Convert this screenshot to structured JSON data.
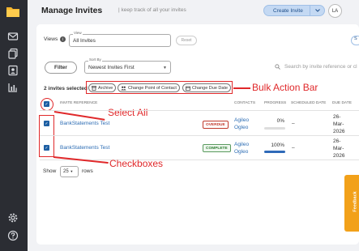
{
  "header": {
    "title": "Manage Invites",
    "subtitle": "| keep track of all your invites",
    "create_button": "Create Invite",
    "avatar_initials": "LA"
  },
  "views": {
    "label": "Views",
    "caption": "View",
    "value": "All Invites",
    "reset": "Reset",
    "edge_button": "S"
  },
  "toolbar": {
    "filter": "Filter",
    "sort_caption": "Sort By",
    "sort_value": "Newest Invites First",
    "search_placeholder": "Search by invite reference or cl"
  },
  "bulk": {
    "selected_text": "2 invites selected",
    "archive": "Archive",
    "change_contact": "Change Point of Contact",
    "change_due": "Change Due Date"
  },
  "table": {
    "headers": {
      "ref": "INVITE REFERENCE",
      "contacts": "CONTACTS",
      "progress": "PROGRESS",
      "scheduled": "SCHEDULED DATE",
      "due": "DUE DATE"
    },
    "rows": [
      {
        "ref": "BankStatements Test",
        "status": "OVERDUE",
        "contact_line1": "Agileo",
        "contact_line2": "Ogleo",
        "progress": 0,
        "progress_label": "0%",
        "scheduled": "–",
        "due_line1": "26-",
        "due_line2": "Mar-",
        "due_line3": "2026"
      },
      {
        "ref": "BankStatements Test",
        "status": "COMPLETE",
        "contact_line1": "Agileo",
        "contact_line2": "Ogleo",
        "progress": 1,
        "progress_label": "100%",
        "scheduled": "–",
        "due_line1": "26-",
        "due_line2": "Mar-",
        "due_line3": "2026"
      }
    ]
  },
  "pagination": {
    "show": "Show",
    "per_page": "25",
    "rows": "rows"
  },
  "annotations": {
    "bulk_action_bar": "Bulk Action Bar",
    "select_all": "Select All",
    "checkboxes": "Checkboxes"
  },
  "feedback_tab": "Feedback",
  "colors": {
    "accent": "#1d5fa3",
    "annotation": "#e0282a",
    "sidebar": "#2b2d33",
    "overdue": "#c0392b",
    "complete": "#2e7d32",
    "feedback": "#f2a11a"
  }
}
